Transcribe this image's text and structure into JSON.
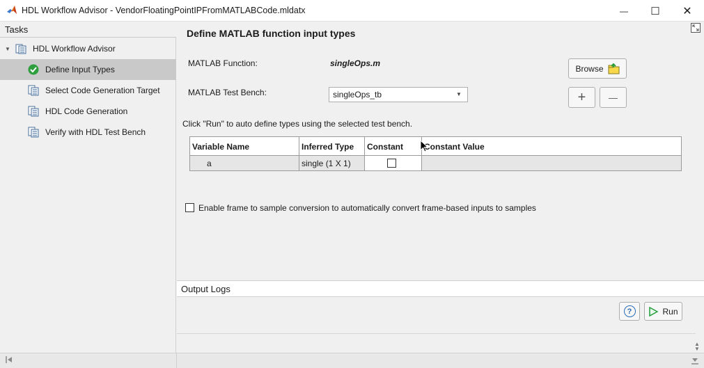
{
  "window": {
    "title": "HDL Workflow Advisor - VendorFloatingPointIPFromMATLABCode.mldatx",
    "minimize_glyph": "—",
    "maximize_glyph": "☐",
    "close_glyph": "✕"
  },
  "tasks": {
    "header": "Tasks",
    "root_label": "HDL Workflow Advisor",
    "items": [
      {
        "label": "Define Input Types",
        "icon": "check-circle-icon",
        "selected": true
      },
      {
        "label": "Select Code Generation Target",
        "icon": "task-doc-icon",
        "selected": false
      },
      {
        "label": "HDL Code Generation",
        "icon": "task-doc-icon",
        "selected": false
      },
      {
        "label": "Verify with HDL Test Bench",
        "icon": "task-doc-icon",
        "selected": false
      }
    ]
  },
  "main": {
    "title": "Define MATLAB function input types",
    "function_label": "MATLAB Function:",
    "function_value": "singleOps.m",
    "testbench_label": "MATLAB Test Bench:",
    "testbench_value": "singleOps_tb",
    "browse_label": "Browse",
    "add_glyph": "+",
    "remove_glyph": "—",
    "hint": "Click \"Run\" to auto define types using the selected test bench.",
    "table": {
      "columns": [
        "Variable Name",
        "Inferred Type",
        "Constant",
        "Constant Value"
      ],
      "rows": [
        {
          "variable": "a",
          "type": "single (1 X 1)",
          "constant": false,
          "constant_value": ""
        }
      ]
    },
    "frame_checkbox_label": "Enable frame to sample conversion to automatically convert frame-based inputs to samples"
  },
  "logs": {
    "header": "Output Logs",
    "help_glyph": "?",
    "run_label": "Run"
  },
  "colors": {
    "selected_row": "#c9c9c9",
    "check_green": "#2e9e3e",
    "run_green": "#1f9e3a",
    "help_blue": "#2a6cb8"
  }
}
